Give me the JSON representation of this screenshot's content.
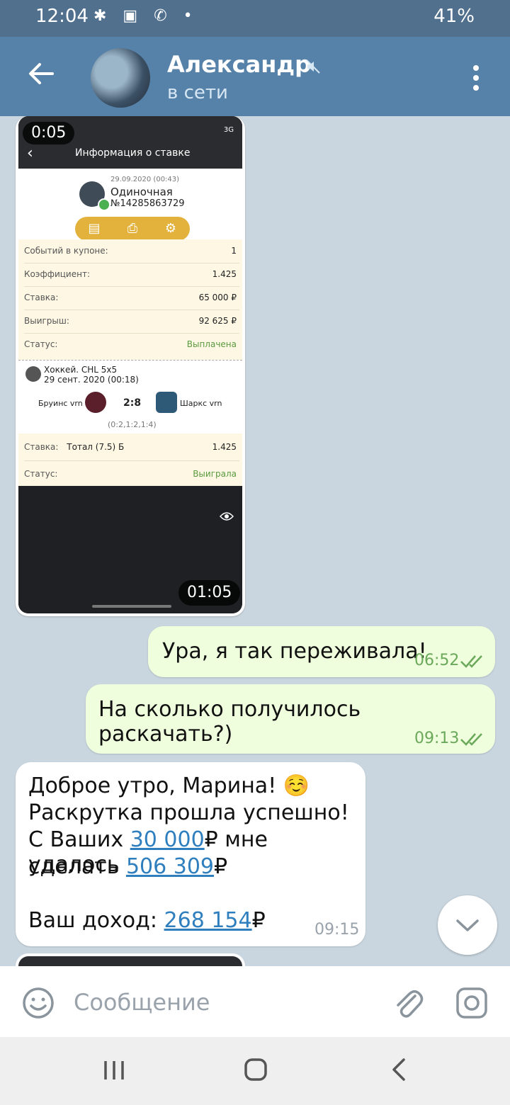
{
  "status_bar": {
    "time": "12:04",
    "battery": "41%"
  },
  "header": {
    "contact_name": "Александр",
    "status": "в сети"
  },
  "video_message": {
    "duration_top": "0:05",
    "duration_bottom": "01:05",
    "screen": {
      "title": "Информация о ставке",
      "network": "3G",
      "bet_date": "29.09.2020 (00:43)",
      "bet_type": "Одиночная",
      "bet_number": "№14285863729",
      "rows": [
        {
          "label": "Событий в купоне:",
          "value": "1"
        },
        {
          "label": "Коэффициент:",
          "value": "1.425"
        },
        {
          "label": "Ставка:",
          "value": "65 000 ₽"
        },
        {
          "label": "Выигрыш:",
          "value": "92 625 ₽"
        },
        {
          "label": "Статус:",
          "value": "Выплачена"
        }
      ],
      "event": {
        "sport": "Хоккей. CHL 5x5",
        "date": "29 сент. 2020 (00:18)",
        "team1": "Бруинс vrn",
        "score": "2:8",
        "team2": "Шаркс vrn",
        "periods": "(0:2,1:2,1:4)"
      },
      "bet_rows": [
        {
          "label": "Ставка:",
          "detail": "Тотал (7.5) Б",
          "value": "1.425"
        },
        {
          "label": "Статус:",
          "detail": "",
          "value": "Выиграла"
        }
      ]
    }
  },
  "messages": [
    {
      "direction": "out",
      "text": "Ура, я так переживала!",
      "time": "06:52"
    },
    {
      "direction": "out",
      "text": "На сколько получилось раскачать?)",
      "time": "09:13"
    },
    {
      "direction": "in",
      "line1": "Доброе утро, Марина! ☺️",
      "line2": "Раскрутка прошла успешно!",
      "line3_prefix": "С Ваших ",
      "line3_amount": "30 000",
      "line3_suffix": "₽ мне удалось",
      "line4_prefix": "сделать ",
      "line4_amount": "506 309",
      "line4_suffix": "₽",
      "line5_prefix": "Ваш доход: ",
      "line5_amount": "268 154",
      "line5_suffix": "₽",
      "time": "09:15"
    }
  ],
  "input": {
    "placeholder": "Сообщение"
  },
  "colors": {
    "header": "#5682a9",
    "outgoing_bubble": "#effedd",
    "link": "#2f7fbf",
    "read_ticks": "#6aa85a"
  }
}
